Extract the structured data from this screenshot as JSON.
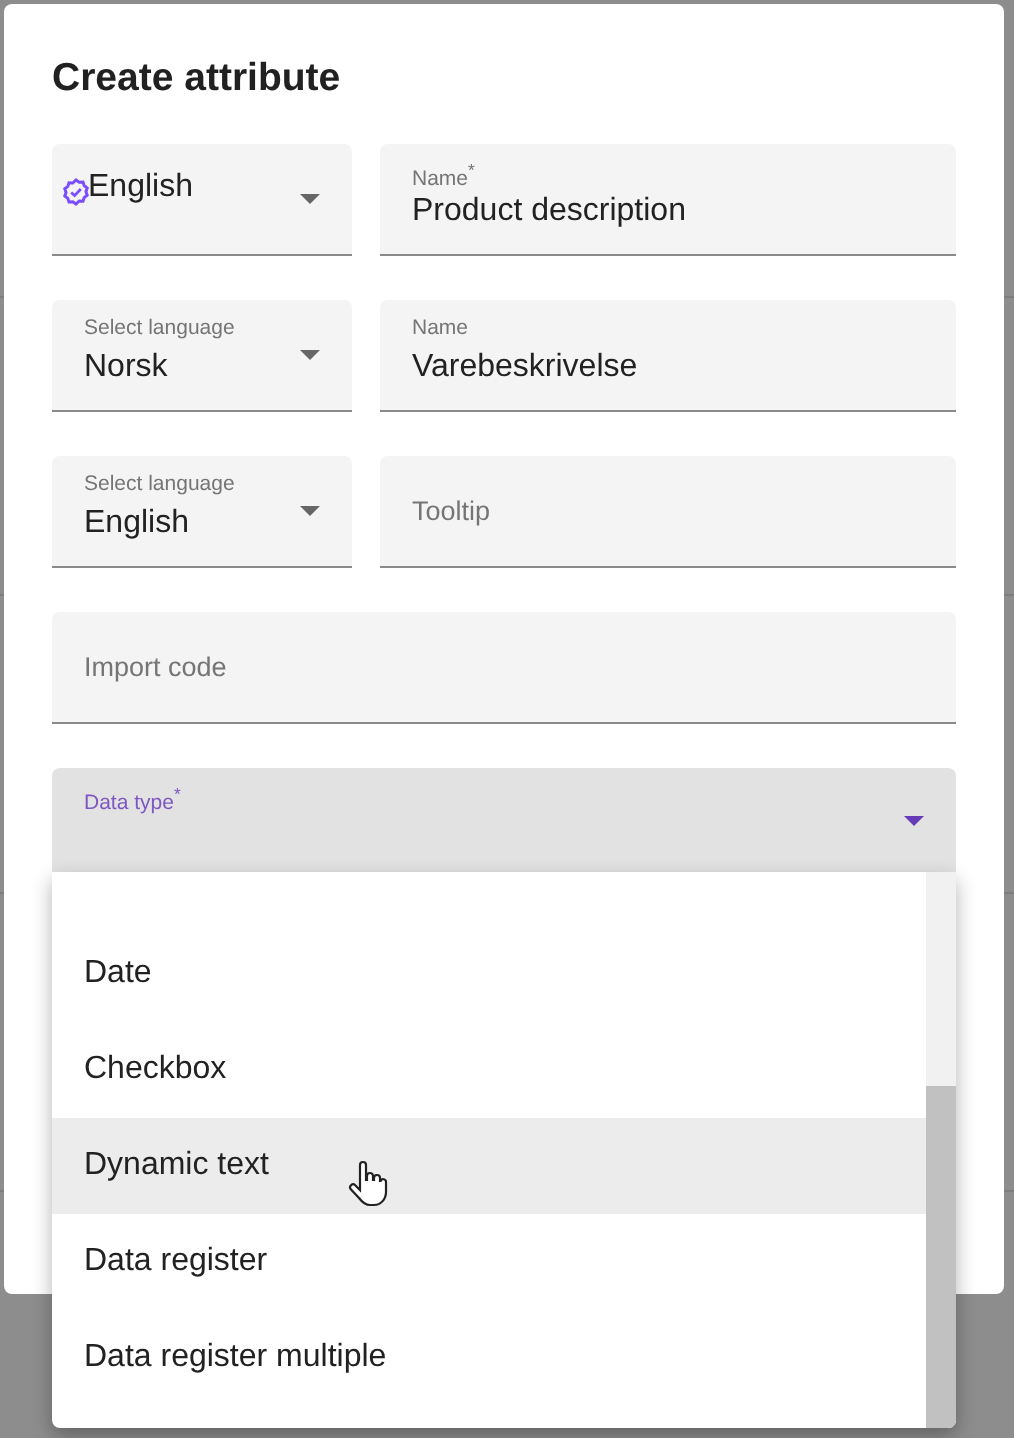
{
  "dialog": {
    "title": "Create attribute",
    "fields": [
      {
        "kind": "select",
        "verified": true,
        "value": "English"
      },
      {
        "kind": "text",
        "label": "Name$^{*}$",
        "value": "Product description"
      },
      {
        "kind": "select",
        "label": "Select language",
        "value": "Norsk"
      },
      {
        "kind": "text",
        "label": "Name",
        "value": "Varebeskrivelse"
      },
      {
        "kind": "select",
        "label": "Select language",
        "value": "English"
      },
      {
        "kind": "text",
        "placeholder": "Tooltip"
      },
      {
        "kind": "text",
        "placeholder": "Import code"
      },
      {
        "kind": "select",
        "label": "Data type$^{*}$",
        "focused": true
      }
    ]
  },
  "menu": {
    "items": [
      {
        "label": "Date",
        "highlighted": false
      },
      {
        "label": "Checkbox",
        "highlighted": false
      },
      {
        "label": "Dynamic text",
        "highlighted": true
      },
      {
        "label": "Data register",
        "highlighted": false
      },
      {
        "label": "Data register multiple",
        "highlighted": false
      }
    ]
  }
}
